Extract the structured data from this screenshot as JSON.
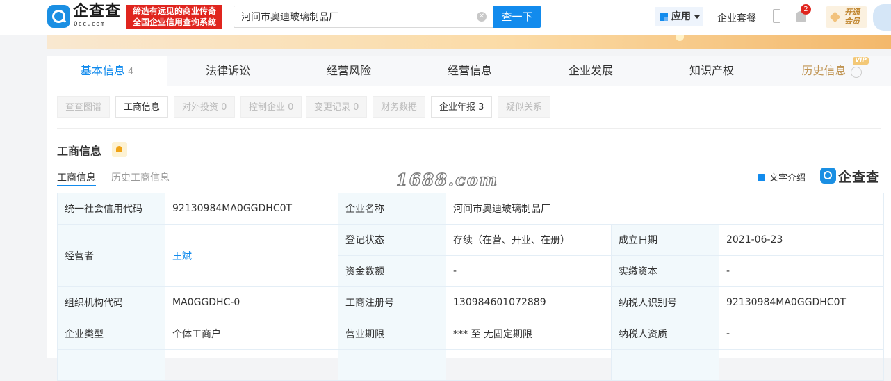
{
  "header": {
    "logo_text": "企查查",
    "logo_sub": "Qcc.com",
    "slogan_line1": "缔造有远见的商业传奇",
    "slogan_line2": "全国企业信用查询系统",
    "search_value": "河间市奥迪玻璃制品厂",
    "search_button": "查一下",
    "apps_label": "应用",
    "package_label": "企业套餐",
    "notification_count": "2",
    "vip_line1": "开通",
    "vip_line2": "会员"
  },
  "tabs": [
    {
      "label": "基本信息",
      "count": "4",
      "active": true
    },
    {
      "label": "法律诉讼"
    },
    {
      "label": "经营风险"
    },
    {
      "label": "经营信息"
    },
    {
      "label": "企业发展"
    },
    {
      "label": "知识产权"
    },
    {
      "label": "历史信息",
      "vip": "VIP"
    }
  ],
  "subtabs": [
    {
      "label": "查查图谱"
    },
    {
      "label": "工商信息"
    },
    {
      "label": "对外投资 0"
    },
    {
      "label": "控制企业 0"
    },
    {
      "label": "变更记录 0"
    },
    {
      "label": "财务数据"
    },
    {
      "label": "企业年报 3"
    },
    {
      "label": "疑似关系"
    }
  ],
  "section": {
    "title": "工商信息",
    "tab_current": "工商信息",
    "tab_history": "历史工商信息",
    "watermark": "1688.com",
    "text_intro": "文字介绍",
    "brand": "企查查"
  },
  "table": {
    "credit_code_label": "统一社会信用代码",
    "credit_code": "92130984MA0GGDHC0T",
    "company_name_label": "企业名称",
    "company_name": "河间市奥迪玻璃制品厂",
    "operator_label": "经营者",
    "operator": "王斌",
    "reg_status_label": "登记状态",
    "reg_status": "存续（在营、开业、在册）",
    "found_date_label": "成立日期",
    "found_date": "2021-06-23",
    "capital_label": "资金数额",
    "capital": "-",
    "paid_capital_label": "实缴资本",
    "paid_capital": "-",
    "org_code_label": "组织机构代码",
    "org_code": "MA0GGDHC-0",
    "reg_no_label": "工商注册号",
    "reg_no": "130984601072889",
    "taxpayer_id_label": "纳税人识别号",
    "taxpayer_id": "92130984MA0GGDHC0T",
    "company_type_label": "企业类型",
    "company_type": "个体工商户",
    "biz_term_label": "营业期限",
    "biz_term": "*** 至 无固定期限",
    "taxpayer_qual_label": "纳税人资质",
    "taxpayer_qual": "-"
  }
}
